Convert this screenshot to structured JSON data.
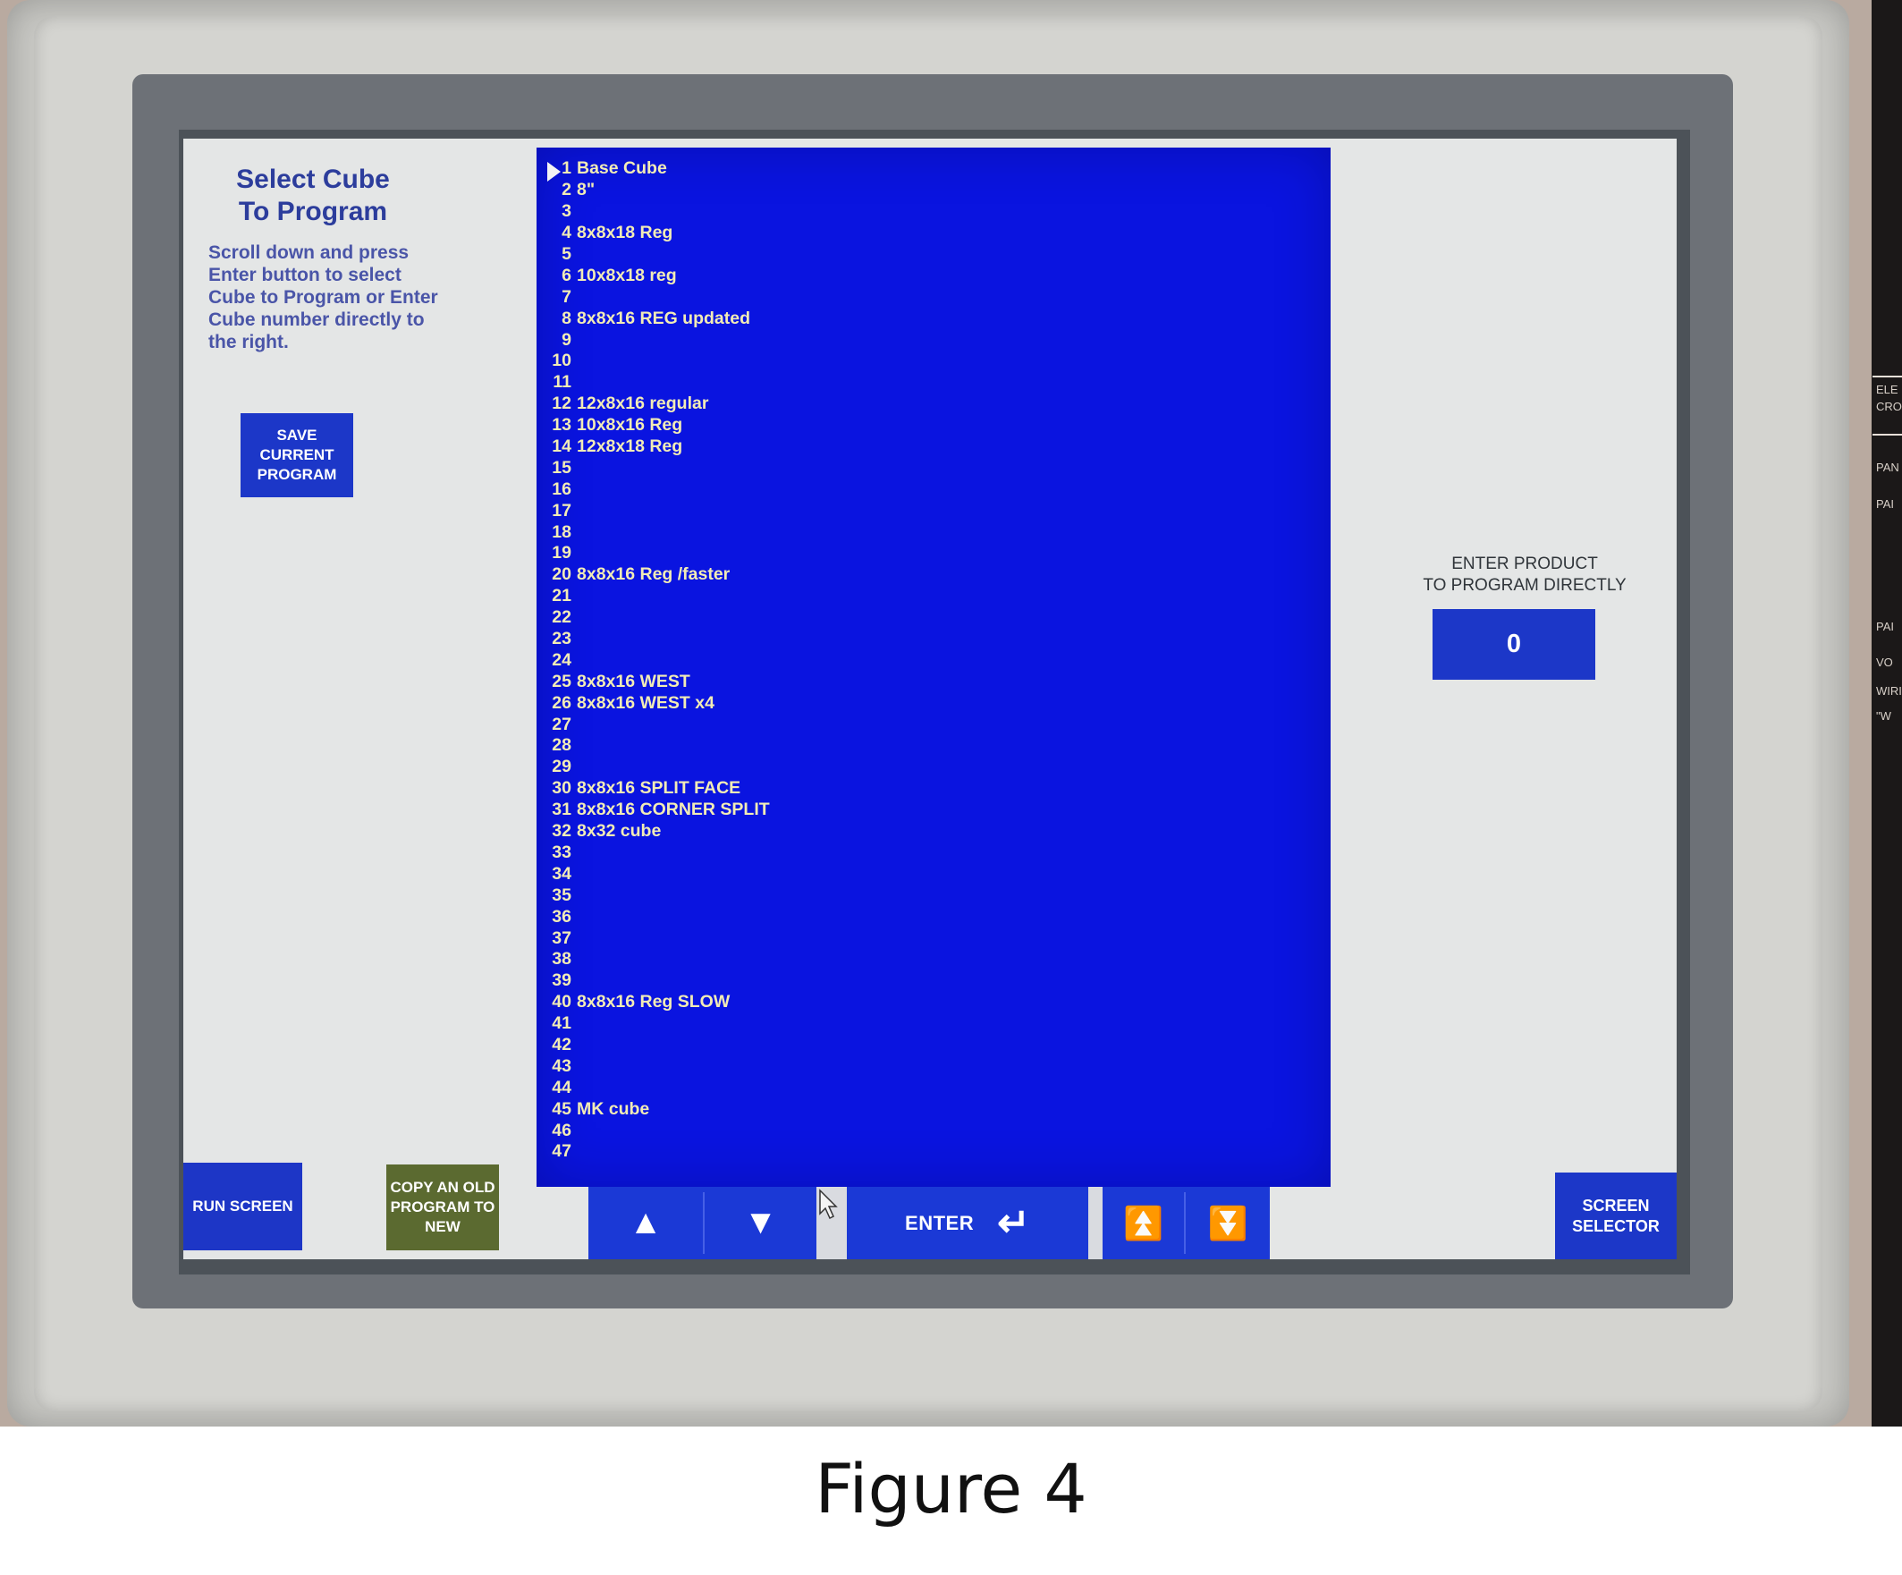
{
  "side_panel_labels": [
    "ELE",
    "CRO",
    "PAN",
    "PAI",
    "PAI",
    "VO",
    "WIRI",
    "\"W"
  ],
  "screen": {
    "title_line1": "Select Cube",
    "title_line2": "To Program",
    "help_text": "Scroll down and press Enter button to select Cube to Program or Enter Cube number directly to the right.",
    "save_button": "SAVE CURRENT PROGRAM",
    "entry_label_line1": "ENTER PRODUCT",
    "entry_label_line2": "TO PROGRAM DIRECTLY",
    "entry_value": "0",
    "run_screen_button": "RUN SCREEN",
    "copy_button": "COPY AN OLD PROGRAM TO NEW",
    "enter_button": "ENTER",
    "enter_glyph": "↵",
    "up_glyph": "▲",
    "down_glyph": "▼",
    "page_up_glyph": "⏫",
    "page_down_glyph": "⏬",
    "screen_selector_button": "SCREEN SELECTOR",
    "colors": {
      "list_bg": "#0a14e0",
      "list_text": "#f2ecb6",
      "button_blue": "#1c37c8",
      "copy_button_olive": "#5b6a30",
      "title_blue": "#2c3d9c"
    },
    "selected_program": 1,
    "programs": [
      {
        "num": "1",
        "name": "Base Cube"
      },
      {
        "num": "2",
        "name": "8\""
      },
      {
        "num": "3",
        "name": ""
      },
      {
        "num": "4",
        "name": "8x8x18 Reg"
      },
      {
        "num": "5",
        "name": ""
      },
      {
        "num": "6",
        "name": "10x8x18 reg"
      },
      {
        "num": "7",
        "name": ""
      },
      {
        "num": "8",
        "name": "8x8x16 REG updated"
      },
      {
        "num": "9",
        "name": ""
      },
      {
        "num": "10",
        "name": ""
      },
      {
        "num": "11",
        "name": ""
      },
      {
        "num": "12",
        "name": "12x8x16 regular"
      },
      {
        "num": "13",
        "name": "10x8x16 Reg"
      },
      {
        "num": "14",
        "name": "12x8x18 Reg"
      },
      {
        "num": "15",
        "name": ""
      },
      {
        "num": "16",
        "name": ""
      },
      {
        "num": "17",
        "name": ""
      },
      {
        "num": "18",
        "name": ""
      },
      {
        "num": "19",
        "name": ""
      },
      {
        "num": "20",
        "name": "8x8x16 Reg /faster"
      },
      {
        "num": "21",
        "name": ""
      },
      {
        "num": "22",
        "name": ""
      },
      {
        "num": "23",
        "name": ""
      },
      {
        "num": "24",
        "name": ""
      },
      {
        "num": "25",
        "name": "8x8x16 WEST"
      },
      {
        "num": "26",
        "name": "8x8x16 WEST x4"
      },
      {
        "num": "27",
        "name": ""
      },
      {
        "num": "28",
        "name": ""
      },
      {
        "num": "29",
        "name": ""
      },
      {
        "num": "30",
        "name": "8x8x16 SPLIT FACE"
      },
      {
        "num": "31",
        "name": "8x8x16 CORNER SPLIT"
      },
      {
        "num": "32",
        "name": "8x32 cube"
      },
      {
        "num": "33",
        "name": ""
      },
      {
        "num": "34",
        "name": ""
      },
      {
        "num": "35",
        "name": ""
      },
      {
        "num": "36",
        "name": ""
      },
      {
        "num": "37",
        "name": ""
      },
      {
        "num": "38",
        "name": ""
      },
      {
        "num": "39",
        "name": ""
      },
      {
        "num": "40",
        "name": "8x8x16 Reg SLOW"
      },
      {
        "num": "41",
        "name": ""
      },
      {
        "num": "42",
        "name": ""
      },
      {
        "num": "43",
        "name": ""
      },
      {
        "num": "44",
        "name": ""
      },
      {
        "num": "45",
        "name": "MK cube"
      },
      {
        "num": "46",
        "name": ""
      },
      {
        "num": "47",
        "name": ""
      }
    ]
  },
  "caption": "Figure 4"
}
